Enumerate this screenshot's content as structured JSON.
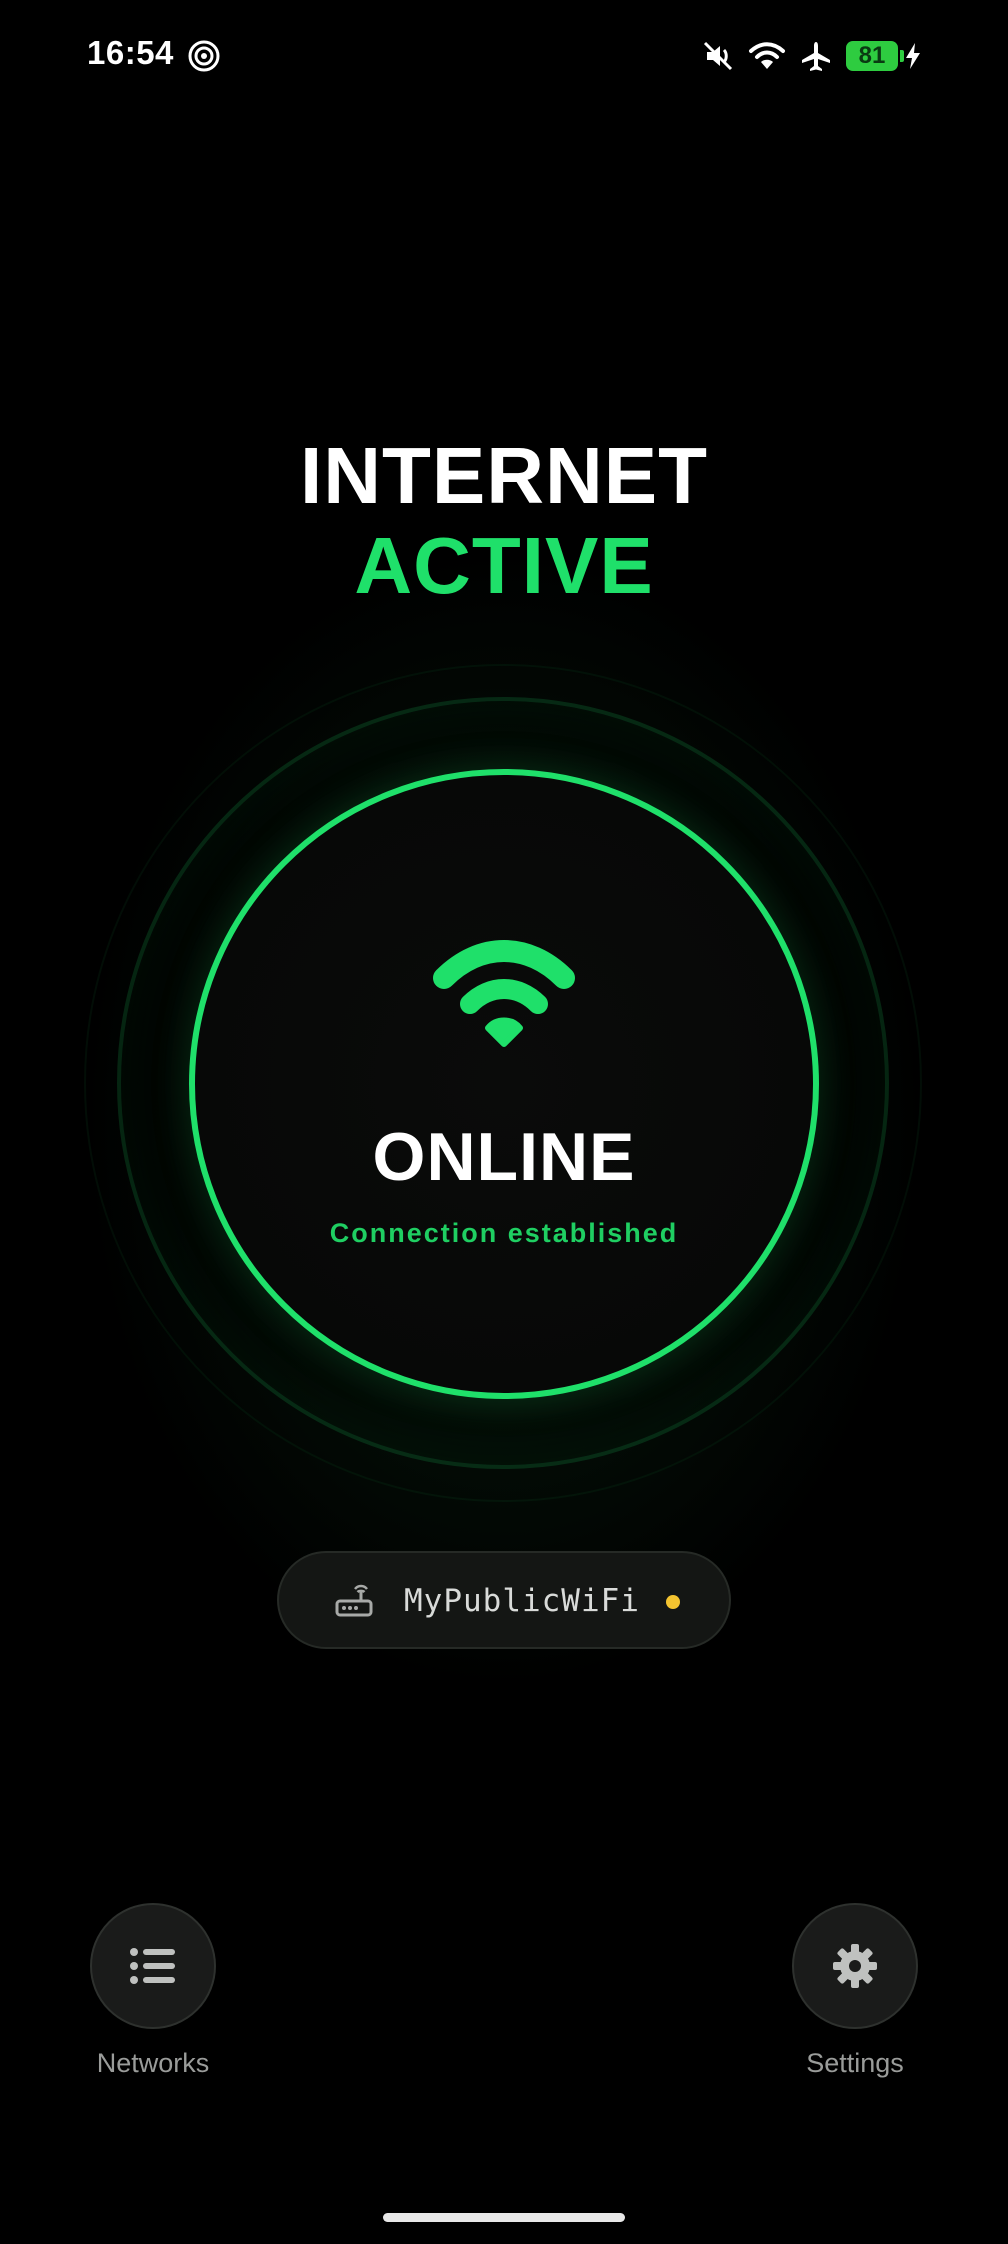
{
  "status_bar": {
    "time": "16:54",
    "battery_level": "81",
    "icons": [
      "hotspot-icon",
      "mute-icon",
      "wifi-icon",
      "airplane-icon",
      "charging-icon"
    ]
  },
  "header": {
    "line1": "INTERNET",
    "line2": "ACTIVE"
  },
  "status_card": {
    "icon": "wifi-icon",
    "state": "ONLINE",
    "subtitle": "Connection established"
  },
  "network": {
    "icon": "router-icon",
    "name": "MyPublicWiFi",
    "dot_color": "#f4c430"
  },
  "bottom_nav": {
    "networks_label": "Networks",
    "settings_label": "Settings"
  },
  "colors": {
    "accent": "#1fe06a",
    "background": "#000000"
  }
}
